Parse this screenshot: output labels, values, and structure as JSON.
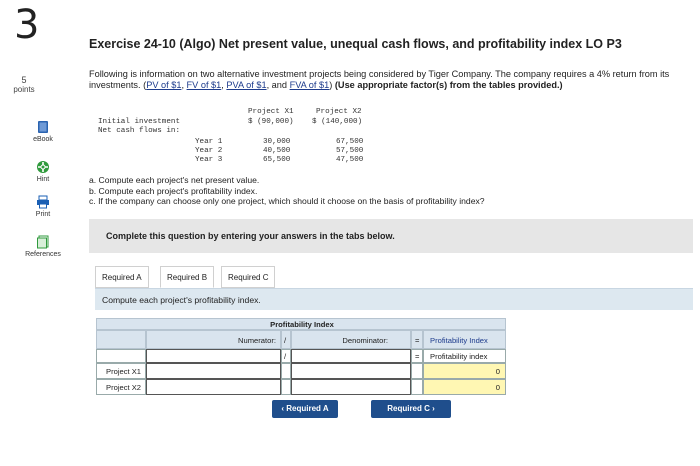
{
  "question": {
    "number": "3",
    "points_value": "5",
    "points_label": "points"
  },
  "sidebar": {
    "items": [
      {
        "label": "eBook"
      },
      {
        "label": "Hint"
      },
      {
        "label": "Print"
      },
      {
        "label": "References"
      }
    ]
  },
  "exercise": {
    "title": "Exercise 24-10 (Algo) Net present value, unequal cash flows, and profitability index LO P3",
    "intro_text": "Following is information on two alternative investment projects being considered by Tiger Company. The company requires a 4% return from its investments. ",
    "links": [
      "PV of $1",
      "FV of $1",
      "PVA of $1",
      "FVA of $1"
    ],
    "link_sep": ", ",
    "link_last_sep": ", and ",
    "instruction_bold": "(Use appropriate factor(s) from the tables provided.)"
  },
  "projects_table": {
    "col_headers": [
      "Project X1",
      "Project X2"
    ],
    "initial_label": "Initial investment",
    "initial_values": [
      "$ (90,000)",
      "$ (140,000)"
    ],
    "cash_flows_label": "Net cash flows in:",
    "years": [
      "Year 1",
      "Year 2",
      "Year 3"
    ],
    "x1": [
      "30,000",
      "40,500",
      "65,500"
    ],
    "x2": [
      "67,500",
      "57,500",
      "47,500"
    ]
  },
  "tasks": [
    "a. Compute each project's net present value.",
    "b. Compute each project's profitability index.",
    "c. If the company can choose only one project, which should it choose on the basis of profitability index?"
  ],
  "complete_notice": "Complete this question by entering your answers in the tabs below.",
  "tabs": [
    "Required A",
    "Required B",
    "Required C"
  ],
  "tab_instruction": "Compute each project's profitability index.",
  "pi_table": {
    "title": "Profitability Index",
    "numerator_label": "Numerator:",
    "divide_symbol": "/",
    "denominator_label": "Denominator:",
    "equals_symbol": "=",
    "result_header": "Profitability Index",
    "result_subheader": "Profitability index",
    "rows": [
      {
        "label": "Project X1",
        "result": "0"
      },
      {
        "label": "Project X2",
        "result": "0"
      }
    ]
  },
  "nav": {
    "prev_label": "Required A",
    "next_label": "Required C"
  }
}
